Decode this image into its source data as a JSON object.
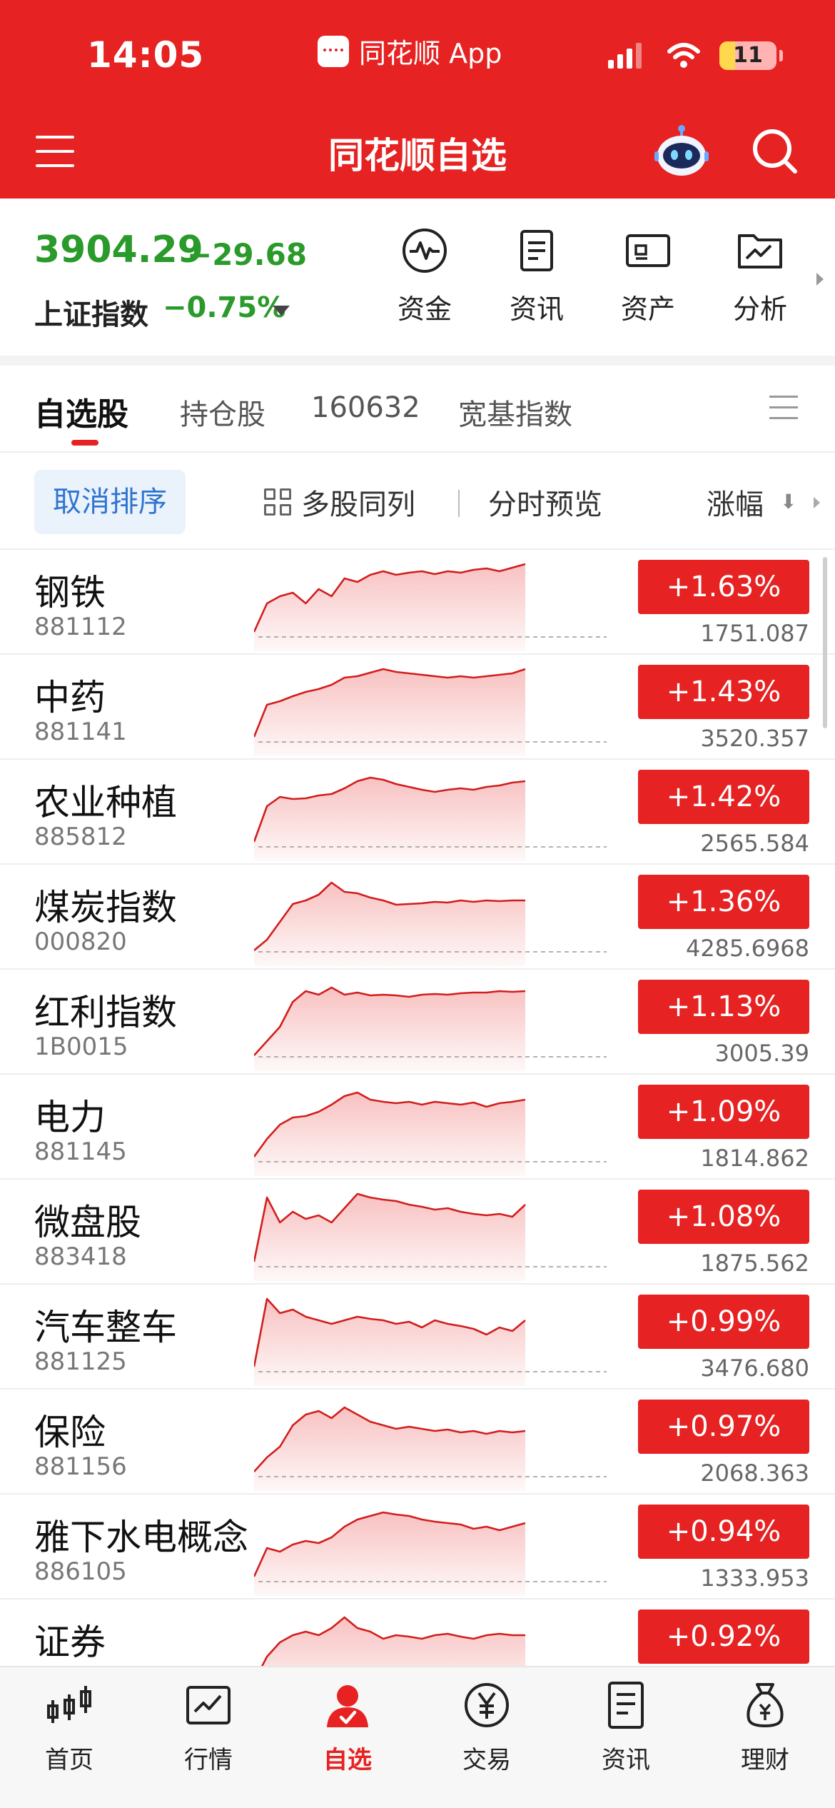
{
  "status_bar": {
    "time": "14:05",
    "app_name": "同花顺 App",
    "battery": "11"
  },
  "header": {
    "title": "同花顺自选"
  },
  "index": {
    "value": "3904.29",
    "change": "−29.68",
    "name": "上证指数",
    "percent": "−0.75%",
    "color": "#2a9a2a"
  },
  "quick_actions": [
    "资金",
    "资讯",
    "资产",
    "分析"
  ],
  "tabs": [
    "自选股",
    "持仓股",
    "160632",
    "宽基指数"
  ],
  "toolbar": {
    "cancel_sort": "取消排序",
    "multi_stock": "多股同列",
    "intraday_preview": "分时预览",
    "sort_column": "涨幅"
  },
  "colors": {
    "brand_red": "#e62222",
    "down_green": "#2a9a2a",
    "link_blue": "#2f74d0"
  },
  "stocks": [
    {
      "name": "钢铁",
      "code": "881112",
      "change": "+1.63%",
      "price": "1751.087"
    },
    {
      "name": "中药",
      "code": "881141",
      "change": "+1.43%",
      "price": "3520.357"
    },
    {
      "name": "农业种植",
      "code": "885812",
      "change": "+1.42%",
      "price": "2565.584"
    },
    {
      "name": "煤炭指数",
      "code": "000820",
      "change": "+1.36%",
      "price": "4285.6968"
    },
    {
      "name": "红利指数",
      "code": "1B0015",
      "change": "+1.13%",
      "price": "3005.39"
    },
    {
      "name": "电力",
      "code": "881145",
      "change": "+1.09%",
      "price": "1814.862"
    },
    {
      "name": "微盘股",
      "code": "883418",
      "change": "+1.08%",
      "price": "1875.562"
    },
    {
      "name": "汽车整车",
      "code": "881125",
      "change": "+0.99%",
      "price": "3476.680"
    },
    {
      "name": "保险",
      "code": "881156",
      "change": "+0.97%",
      "price": "2068.363"
    },
    {
      "name": "雅下水电概念",
      "code": "886105",
      "change": "+0.94%",
      "price": "1333.953"
    },
    {
      "name": "证券",
      "code": "",
      "change": "+0.92%",
      "price": ""
    }
  ],
  "bottom_nav": [
    {
      "label": "首页",
      "icon": "candlestick-icon"
    },
    {
      "label": "行情",
      "icon": "chart-icon"
    },
    {
      "label": "自选",
      "icon": "user-check-icon"
    },
    {
      "label": "交易",
      "icon": "yuan-icon"
    },
    {
      "label": "资讯",
      "icon": "document-icon"
    },
    {
      "label": "理财",
      "icon": "money-bag-icon"
    }
  ]
}
